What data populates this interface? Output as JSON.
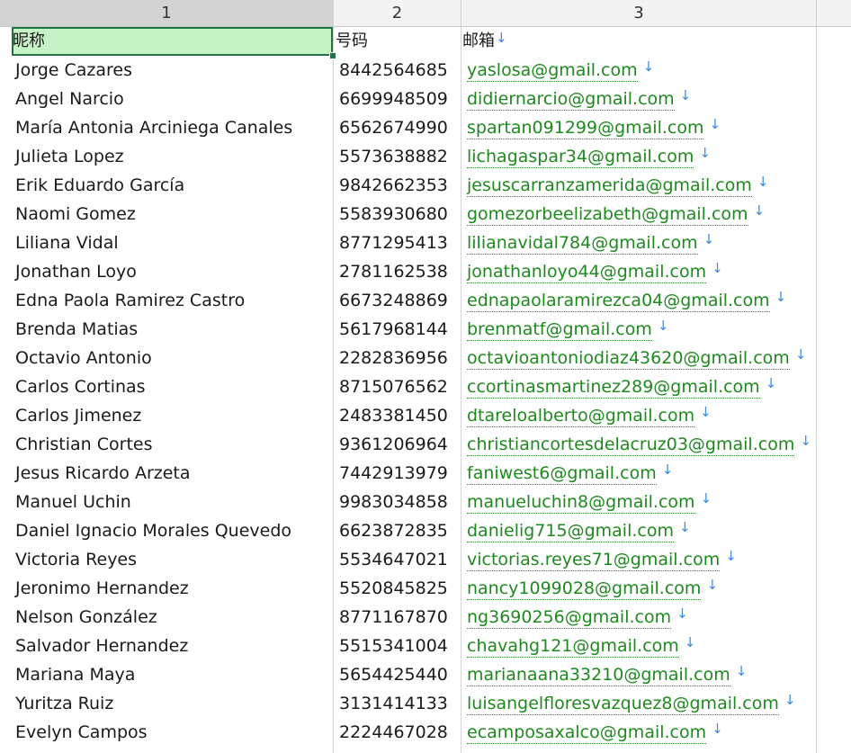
{
  "columns": [
    "1",
    "2",
    "3"
  ],
  "header": {
    "name": "昵称",
    "phone": "号码",
    "email": "邮箱"
  },
  "sort_arrow": "↓",
  "rows": [
    {
      "name": "Jorge Cazares",
      "phone": "8442564685",
      "email": "yaslosa@gmail.com"
    },
    {
      "name": "Angel Narcio",
      "phone": "6699948509",
      "email": "didiernarcio@gmail.com"
    },
    {
      "name": "María Antonia Arciniega Canales",
      "phone": "6562674990",
      "email": "spartan091299@gmail.com"
    },
    {
      "name": "Julieta Lopez",
      "phone": "5573638882",
      "email": "lichagaspar34@gmail.com"
    },
    {
      "name": "Erik Eduardo García",
      "phone": "9842662353",
      "email": "jesuscarranzamerida@gmail.com"
    },
    {
      "name": "Naomi Gomez",
      "phone": "5583930680",
      "email": "gomezorbeelizabeth@gmail.com"
    },
    {
      "name": "Liliana Vidal",
      "phone": "8771295413",
      "email": "lilianavidal784@gmail.com"
    },
    {
      "name": "Jonathan Loyo",
      "phone": "2781162538",
      "email": "jonathanloyo44@gmail.com"
    },
    {
      "name": "Edna Paola Ramirez Castro",
      "phone": "6673248869",
      "email": "ednapaolaramirezca04@gmail.com"
    },
    {
      "name": "Brenda Matias",
      "phone": "5617968144",
      "email": "brenmatf@gmail.com"
    },
    {
      "name": "Octavio Antonio",
      "phone": "2282836956",
      "email": "octavioantoniodiaz43620@gmail.com"
    },
    {
      "name": "Carlos Cortinas",
      "phone": "8715076562",
      "email": "ccortinasmartinez289@gmail.com"
    },
    {
      "name": "Carlos Jimenez",
      "phone": "2483381450",
      "email": "dtareloalberto@gmail.com"
    },
    {
      "name": "Christian Cortes",
      "phone": "9361206964",
      "email": "christiancortesdelacruz03@gmail.com"
    },
    {
      "name": "Jesus Ricardo Arzeta",
      "phone": "7442913979",
      "email": "faniwest6@gmail.com"
    },
    {
      "name": "Manuel Uchin",
      "phone": "9983034858",
      "email": "manueluchin8@gmail.com"
    },
    {
      "name": "Daniel Ignacio Morales Quevedo",
      "phone": "6623872835",
      "email": "danielig715@gmail.com"
    },
    {
      "name": "Victoria Reyes",
      "phone": "5534647021",
      "email": "victorias.reyes71@gmail.com"
    },
    {
      "name": "Jeronimo Hernandez",
      "phone": "5520845825",
      "email": "nancy1099028@gmail.com"
    },
    {
      "name": "Nelson González",
      "phone": "8771167870",
      "email": "ng3690256@gmail.com"
    },
    {
      "name": "Salvador Hernandez",
      "phone": "5515341004",
      "email": "chavahg121@gmail.com"
    },
    {
      "name": "Mariana Maya",
      "phone": "5654425440",
      "email": "marianaana33210@gmail.com"
    },
    {
      "name": "Yuritza Ruiz",
      "phone": "3131414133",
      "email": "luisangelfloresvazquez8@gmail.com"
    },
    {
      "name": "Evelyn Campos",
      "phone": "2224467028",
      "email": "ecamposaxalco@gmail.com"
    }
  ]
}
